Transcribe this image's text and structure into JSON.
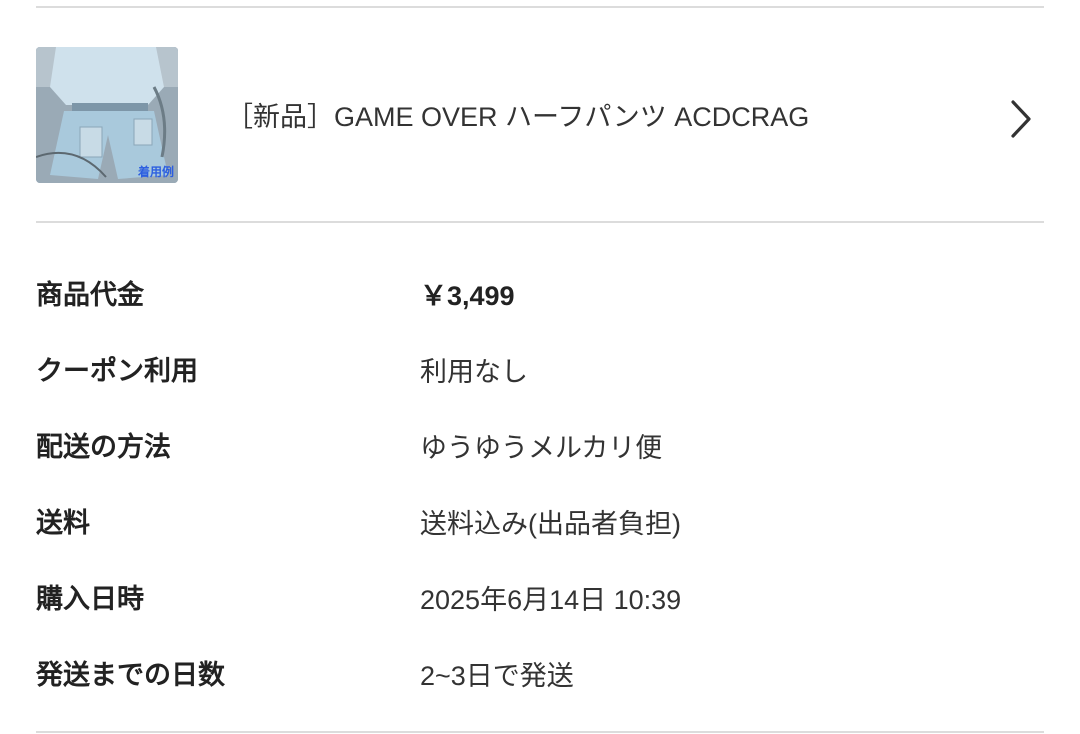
{
  "product": {
    "title": "［新品］GAME OVER ハーフパンツ ACDCRAG",
    "thumbnail_caption": "着用例",
    "chevron_icon": "chevron-right-icon"
  },
  "details": [
    {
      "label": "商品代金",
      "value": "￥3,499",
      "emphasis": true
    },
    {
      "label": "クーポン利用",
      "value": "利用なし",
      "emphasis": false
    },
    {
      "label": "配送の方法",
      "value": "ゆうゆうメルカリ便",
      "emphasis": false
    },
    {
      "label": "送料",
      "value": "送料込み(出品者負担)",
      "emphasis": false
    },
    {
      "label": "購入日時",
      "value": "2025年6月14日 10:39",
      "emphasis": false
    },
    {
      "label": "発送までの日数",
      "value": "2~3日で発送",
      "emphasis": false
    }
  ],
  "colors": {
    "divider": "#dcdcdc",
    "text_primary": "#222222",
    "caption_blue": "#2d5fe0"
  }
}
